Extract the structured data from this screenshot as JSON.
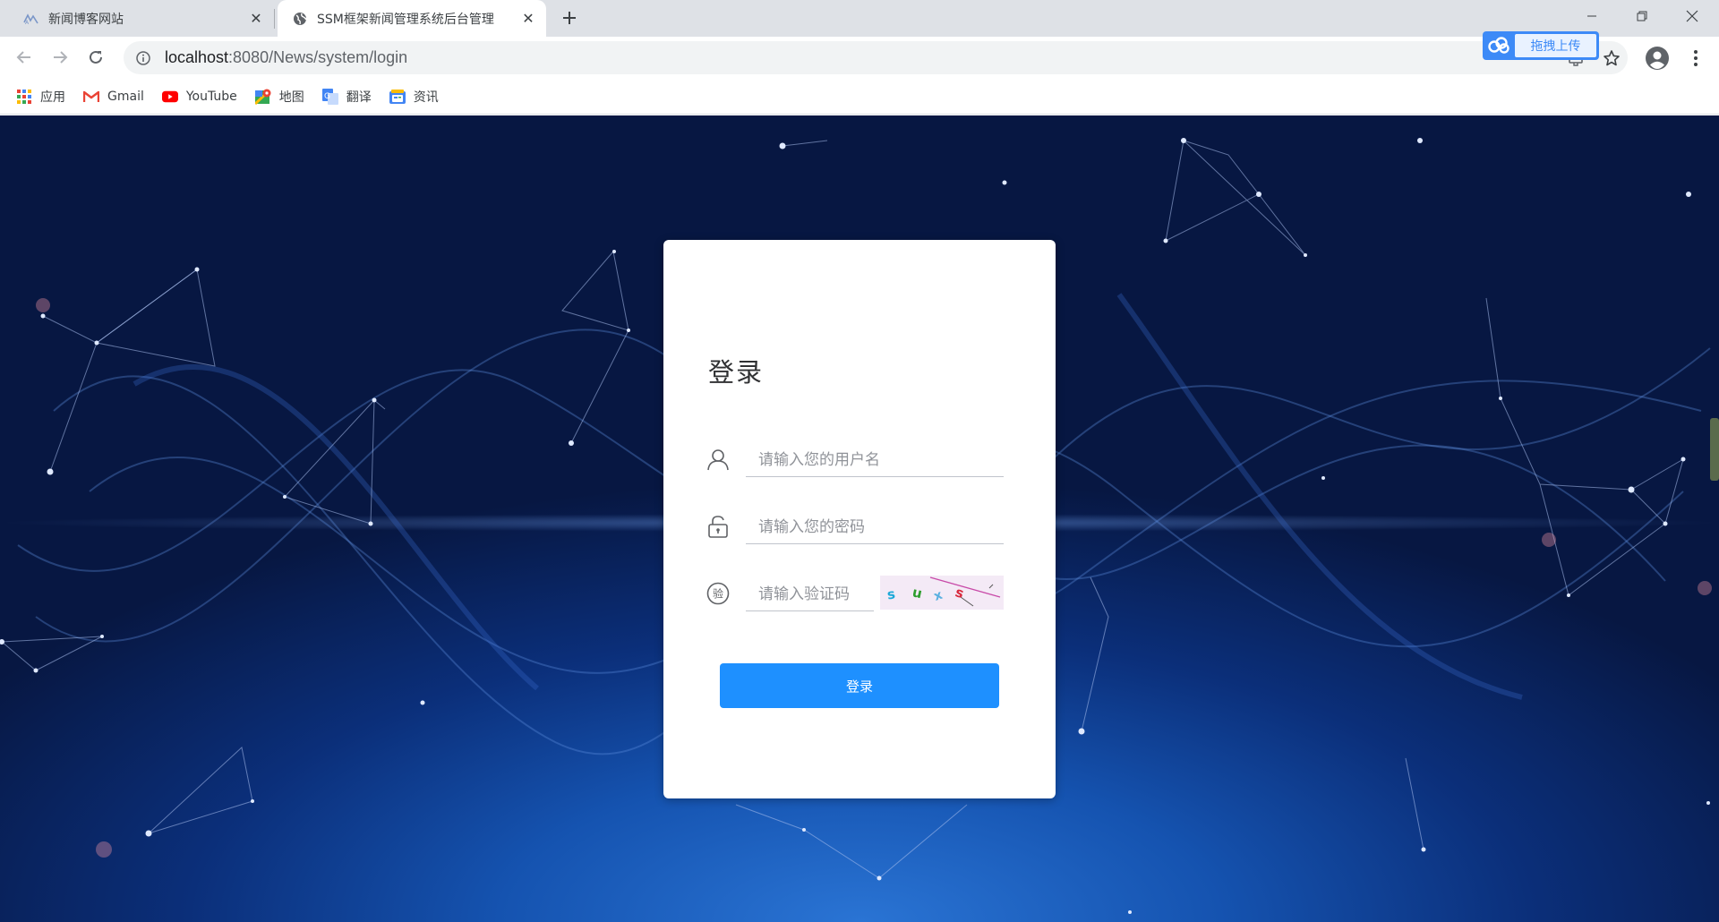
{
  "browser": {
    "tabs": [
      {
        "title": "新闻博客网站",
        "favicon": "news-site-icon",
        "active": false
      },
      {
        "title": "SSM框架新闻管理系统后台管理",
        "favicon": "globe-icon",
        "active": true
      }
    ],
    "url": {
      "host": "localhost",
      "rest": ":8080/News/system/login"
    },
    "bookmarks": [
      {
        "label": "应用",
        "icon": "apps-grid-icon"
      },
      {
        "label": "Gmail",
        "icon": "gmail-icon"
      },
      {
        "label": "YouTube",
        "icon": "youtube-icon"
      },
      {
        "label": "地图",
        "icon": "maps-icon"
      },
      {
        "label": "翻译",
        "icon": "translate-icon"
      },
      {
        "label": "资讯",
        "icon": "news-icon"
      }
    ],
    "upload_extension_label": "拖拽上传"
  },
  "login": {
    "title": "登录",
    "username_placeholder": "请输入您的用户名",
    "password_placeholder": "请输入您的密码",
    "code_placeholder": "请输入验证码",
    "code_icon_char": "验",
    "captcha_chars": [
      "s",
      "u",
      "x",
      "s"
    ],
    "submit_label": "登录"
  },
  "colors": {
    "primary_button": "#1e90ff",
    "background_dark": "#071742",
    "background_glow": "#2a74d4"
  }
}
